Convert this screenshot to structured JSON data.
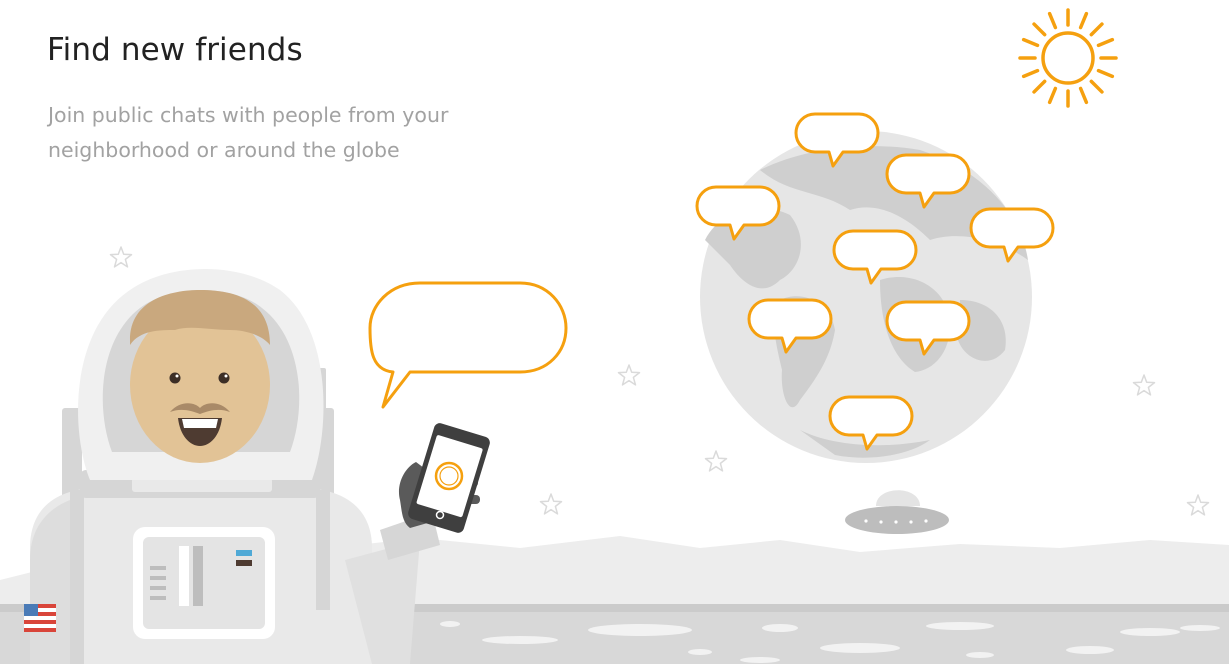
{
  "header": {
    "title": "Find new friends",
    "subtitle_line1": "Join public chats with people from your",
    "subtitle_line2": "neighborhood or around the globe"
  },
  "illustration": {
    "scene": "astronaut-on-moon",
    "icons": [
      "sun-icon",
      "globe-icon",
      "chat-bubble-icon",
      "astronaut-icon",
      "smartphone-icon",
      "ufo-icon",
      "star-icon",
      "us-flag-icon"
    ],
    "colors": {
      "accent": "#F5A00F",
      "gray_light": "#E8E8E8",
      "gray_mid": "#D0D0D0",
      "gray_dark": "#5A5A5A",
      "skin": "#E2C396",
      "hair": "#C9A87E",
      "mustache": "#A98A68"
    }
  }
}
